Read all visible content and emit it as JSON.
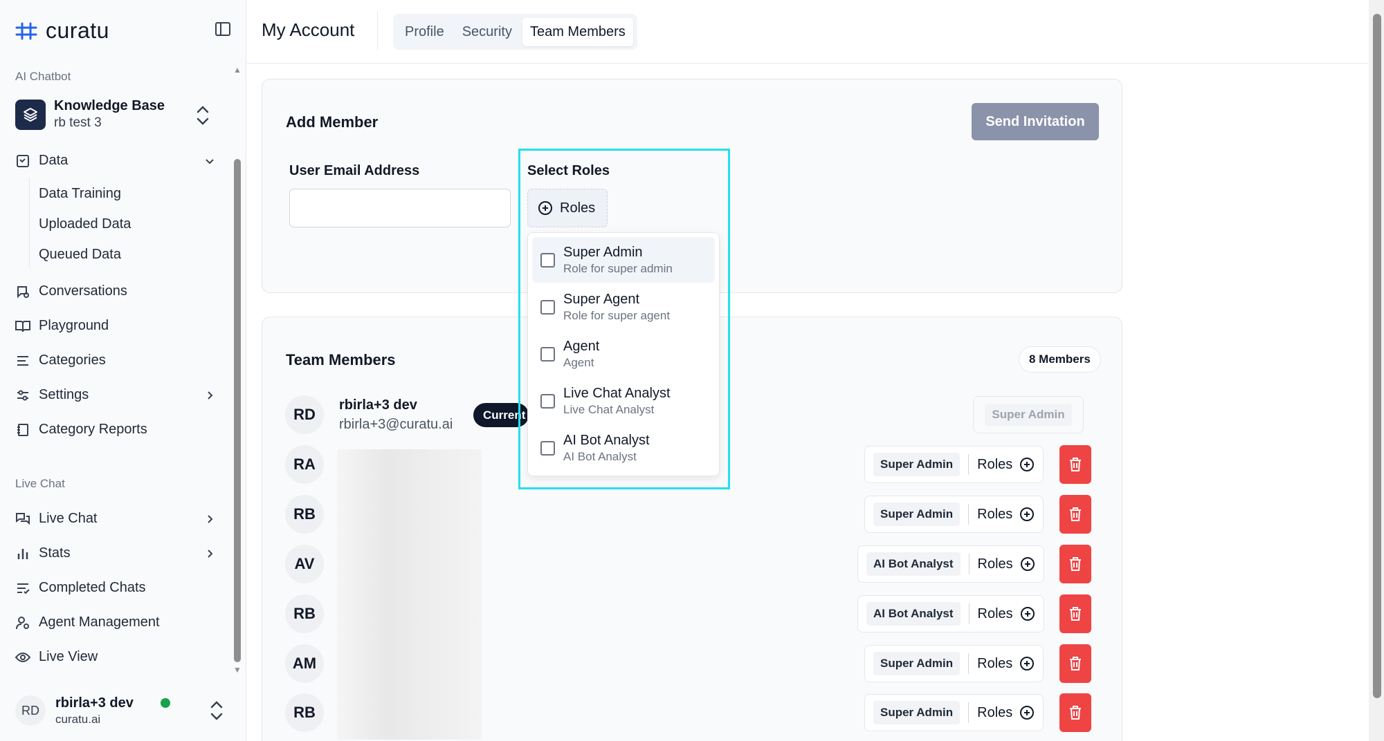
{
  "app": {
    "brand": "curatu"
  },
  "sidebar": {
    "section_ai": "AI Chatbot",
    "kb_title": "Knowledge Base",
    "kb_sub": "rb test 3",
    "data_label": "Data",
    "sub_items": [
      "Data Training",
      "Uploaded Data",
      "Queued Data"
    ],
    "conversations": "Conversations",
    "playground": "Playground",
    "categories": "Categories",
    "settings": "Settings",
    "category_reports": "Category Reports",
    "section_live": "Live Chat",
    "live_chat": "Live Chat",
    "stats": "Stats",
    "completed_chats": "Completed Chats",
    "agent_management": "Agent Management",
    "live_view": "Live View",
    "user": {
      "initials": "RD",
      "name": "rbirla+3 dev",
      "org": "curatu.ai"
    }
  },
  "header": {
    "title": "My Account",
    "tabs": [
      "Profile",
      "Security",
      "Team Members"
    ],
    "active_tab": "Team Members"
  },
  "add_member": {
    "title": "Add Member",
    "send_label": "Send Invitation",
    "email_label": "User Email Address",
    "email_value": "",
    "roles_label": "Select Roles",
    "roles_button": "Roles",
    "options": [
      {
        "title": "Super Admin",
        "sub": "Role for super admin"
      },
      {
        "title": "Super Agent",
        "sub": "Role for super agent"
      },
      {
        "title": "Agent",
        "sub": "Agent"
      },
      {
        "title": "Live Chat Analyst",
        "sub": "Live Chat Analyst"
      },
      {
        "title": "AI Bot Analyst",
        "sub": "AI Bot Analyst"
      }
    ]
  },
  "team": {
    "title": "Team Members",
    "count_label": "8 Members",
    "current": {
      "initials": "RD",
      "name": "rbirla+3 dev",
      "email": "rbirla+3@curatu.ai",
      "badge": "Current",
      "role": "Super Admin"
    },
    "roles_add_label": "Roles",
    "members": [
      {
        "initials": "RA",
        "role": "Super Admin"
      },
      {
        "initials": "RB",
        "role": "Super Admin"
      },
      {
        "initials": "AV",
        "role": "AI Bot Analyst"
      },
      {
        "initials": "RB",
        "role": "AI Bot Analyst"
      },
      {
        "initials": "AM",
        "role": "Super Admin"
      },
      {
        "initials": "RB",
        "role": "Super Admin"
      }
    ]
  },
  "colors": {
    "primary_dark": "#1e2a4a",
    "delete": "#ef4444",
    "highlight": "#22e0ee",
    "online": "#16a34a"
  }
}
